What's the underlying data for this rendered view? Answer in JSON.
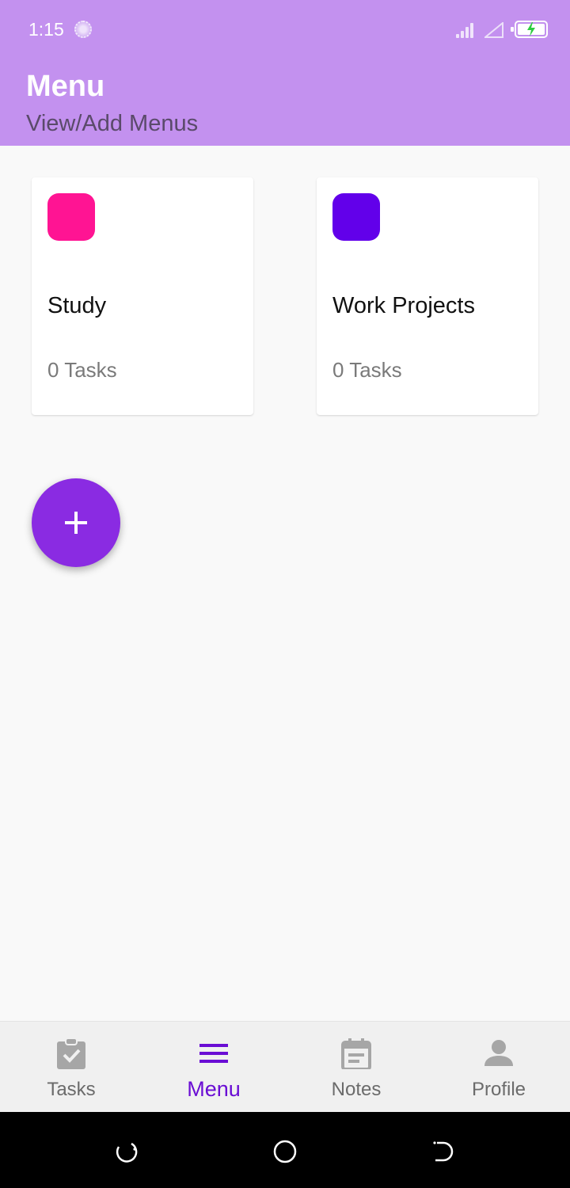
{
  "status_bar": {
    "time": "1:15"
  },
  "header": {
    "title": "Menu",
    "subtitle": "View/Add Menus",
    "background": "#c391ef"
  },
  "menus": [
    {
      "name": "Study",
      "count": "0 Tasks",
      "color": "#ff1493"
    },
    {
      "name": "Work Projects",
      "count": "0 Tasks",
      "color": "#6200ea"
    }
  ],
  "fab": {
    "icon": "plus-icon",
    "color": "#8a2be2"
  },
  "bottom_nav": {
    "items": [
      {
        "label": "Tasks",
        "icon": "clipboard-check-icon",
        "active": false
      },
      {
        "label": "Menu",
        "icon": "menu-icon",
        "active": true
      },
      {
        "label": "Notes",
        "icon": "notes-calendar-icon",
        "active": false
      },
      {
        "label": "Profile",
        "icon": "person-icon",
        "active": false
      }
    ],
    "active_color": "#6a0dd4"
  },
  "system_nav": {
    "buttons": [
      "recents-icon",
      "home-icon",
      "back-icon"
    ]
  }
}
